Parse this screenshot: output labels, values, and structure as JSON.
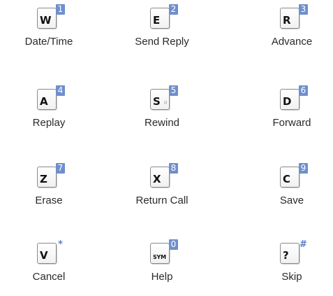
{
  "keys": [
    {
      "letter": "W",
      "badge": "1",
      "label": "Date/Time"
    },
    {
      "letter": "E",
      "badge": "2",
      "label": "Send Reply"
    },
    {
      "letter": "R",
      "badge": "3",
      "label": "Advance"
    },
    {
      "letter": "A",
      "badge": "4",
      "label": "Replay"
    },
    {
      "letter": "S",
      "badge": "5",
      "extra": "○",
      "label": "Rewind"
    },
    {
      "letter": "D",
      "badge": "6",
      "label": "Forward"
    },
    {
      "letter": "Z",
      "badge": "7",
      "label": "Erase"
    },
    {
      "letter": "X",
      "badge": "8",
      "label": "Return Call"
    },
    {
      "letter": "C",
      "badge": "9",
      "label": "Save"
    },
    {
      "letter": "V",
      "badge": "*",
      "label": "Cancel"
    },
    {
      "letter": "SYM",
      "badge": "0",
      "label": "Help"
    },
    {
      "letter": "?",
      "badge": "#",
      "label": "Skip"
    }
  ],
  "colors": {
    "badge": "#6f8fcc",
    "label": "#2a2a2a"
  }
}
